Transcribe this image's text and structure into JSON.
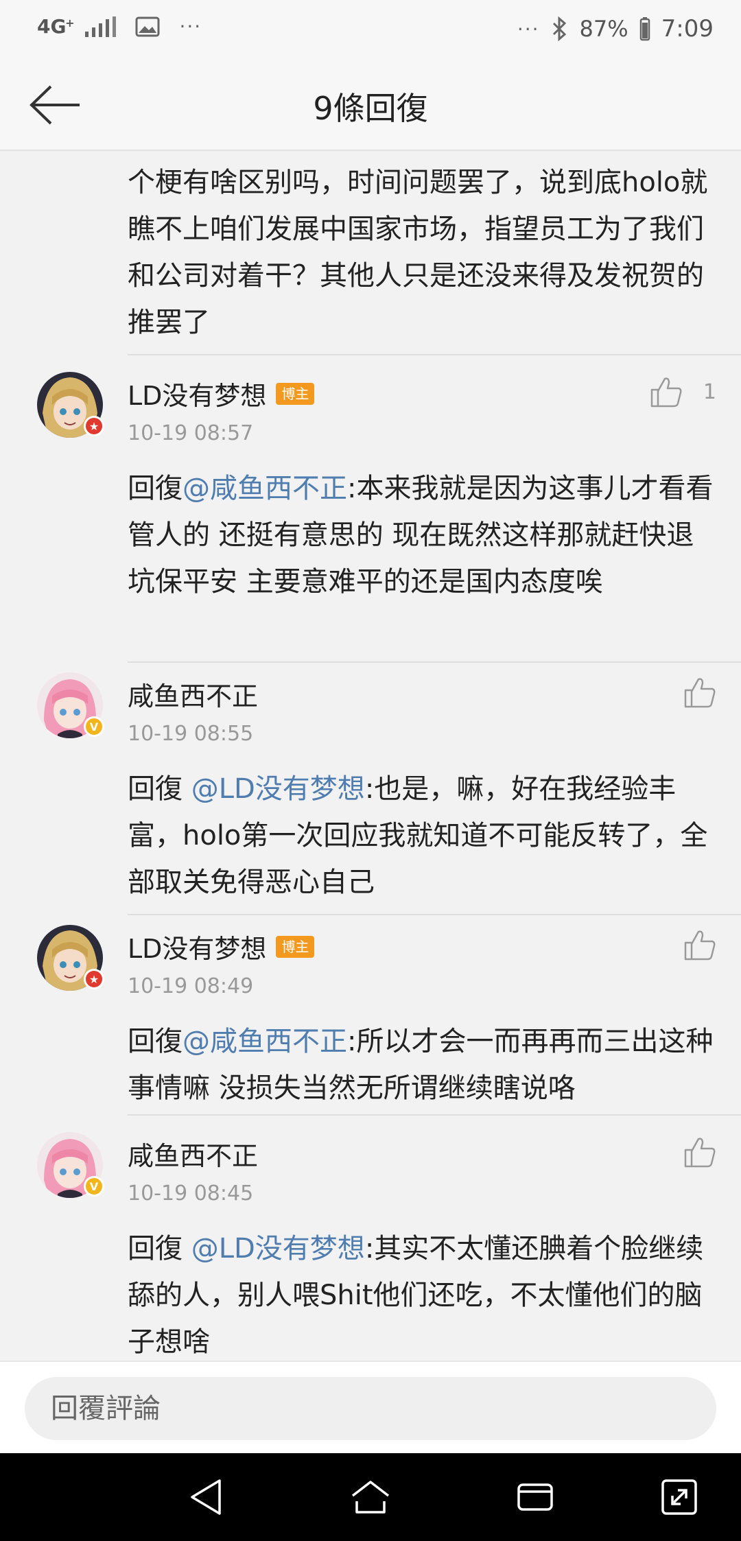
{
  "status_bar": {
    "network": "4G",
    "network_sub": "+",
    "more_left": "···",
    "more_right": "···",
    "battery": "87%",
    "time": "7:09",
    "icons": [
      "signal-icon",
      "image-icon",
      "bluetooth-icon",
      "battery-icon"
    ]
  },
  "header": {
    "title": "9條回復"
  },
  "partial_comment": {
    "text": "个梗有啥区别吗，时间问题罢了，说到底holo就瞧不上咱们发展中国家市场，指望员工为了我们和公司对着干？其他人只是还没来得及发祝贺的推罢了"
  },
  "comments": [
    {
      "username": "LD没有梦想",
      "tag": "博主",
      "time": "10-19 08:57",
      "likes": "1",
      "reply_prefix": "回復",
      "mention": "@咸鱼西不正",
      "text": ":本来我就是因为这事儿才看看管人的 还挺有意思的 现在既然这样那就赶快退坑保平安 主要意难平的还是国内态度唉"
    },
    {
      "username": "咸鱼西不正",
      "tag": "",
      "time": "10-19 08:55",
      "likes": "",
      "reply_prefix": "回復 ",
      "mention": "@LD没有梦想",
      "text": ":也是，嘛，好在我经验丰富，holo第一次回应我就知道不可能反转了，全部取关免得恶心自己"
    },
    {
      "username": "LD没有梦想",
      "tag": "博主",
      "time": "10-19 08:49",
      "likes": "",
      "reply_prefix": "回復",
      "mention": "@咸鱼西不正",
      "text": ":所以才会一而再再而三出这种事情嘛 没损失当然无所谓继续瞎说咯"
    },
    {
      "username": "咸鱼西不正",
      "tag": "",
      "time": "10-19 08:45",
      "likes": "",
      "reply_prefix": "回復 ",
      "mention": "@LD没有梦想",
      "text": ":其实不太懂还腆着个脸继续舔的人，别人喂Shit他们还吃，不太懂他们的脑子想啥"
    }
  ],
  "reply_bar": {
    "placeholder": "回覆評論"
  },
  "colors": {
    "mention": "#507daf",
    "author_tag": "#f3991f",
    "badge_red": "#e0392d",
    "badge_yellow": "#f3b51c"
  }
}
